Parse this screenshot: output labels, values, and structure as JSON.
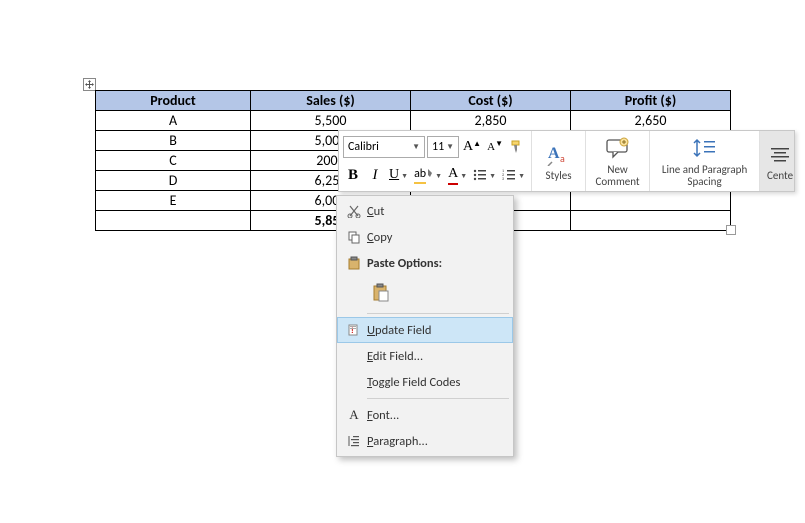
{
  "table": {
    "headers": [
      "Product",
      "Sales ($)",
      "Cost ($)",
      "Profit ($)"
    ],
    "rows": [
      {
        "product": "A",
        "sales": "5,500",
        "cost": "2,850",
        "profit": "2,650"
      },
      {
        "product": "B",
        "sales": "5,000",
        "cost": "",
        "profit": ""
      },
      {
        "product": "C",
        "sales": "2000",
        "cost": "",
        "profit": ""
      },
      {
        "product": "D",
        "sales": "6,250",
        "cost": "",
        "profit": ""
      },
      {
        "product": "E",
        "sales": "6,000",
        "cost": "",
        "profit": ""
      }
    ],
    "total": {
      "product": "",
      "sales": "5,850",
      "cost": "",
      "profit": ""
    }
  },
  "mini_toolbar": {
    "font_name": "Calibri",
    "font_size": "11",
    "styles_label": "Styles",
    "new_comment_label_l1": "New",
    "new_comment_label_l2": "Comment",
    "spacing_label_l1": "Line and Paragraph",
    "spacing_label_l2": "Spacing",
    "center_label": "Cente"
  },
  "context_menu": {
    "cut": "Cut",
    "copy": "Copy",
    "paste_options": "Paste Options:",
    "update_field": "Update Field",
    "edit_field": "Edit Field...",
    "toggle_field_codes": "Toggle Field Codes",
    "font": "Font...",
    "paragraph": "Paragraph..."
  }
}
